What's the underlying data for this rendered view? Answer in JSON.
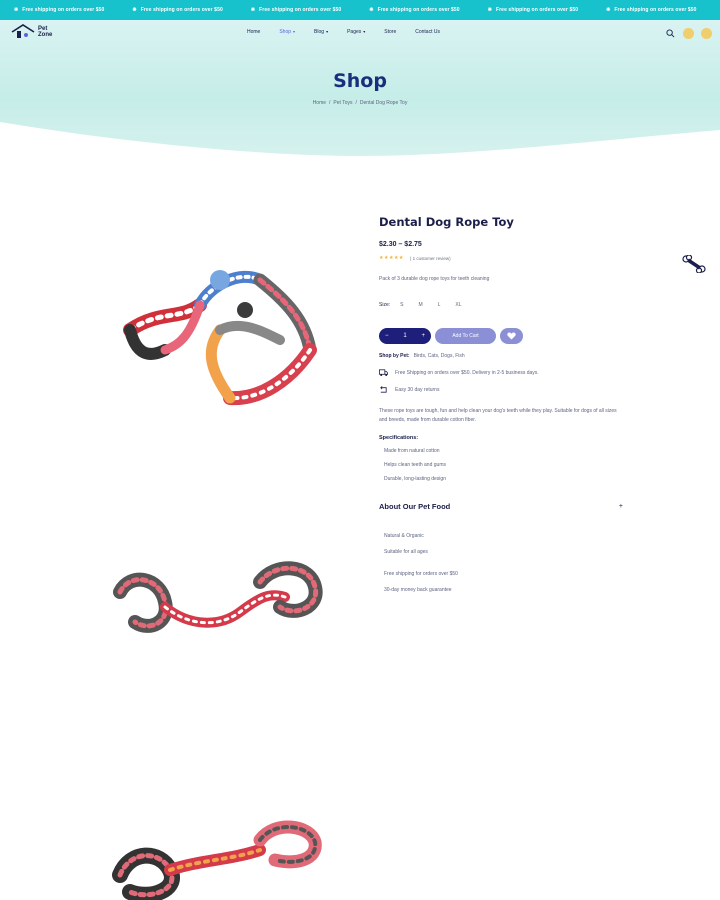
{
  "ticker": {
    "items": [
      "Free shipping on orders over $50",
      "Free shipping on orders over $50",
      "Free shipping on orders over $50",
      "Free shipping on orders over $50",
      "Free shipping on orders over $50",
      "Free shipping on orders over $50"
    ]
  },
  "brand": {
    "line1": "Pet",
    "line2": "Zone"
  },
  "nav": {
    "items": [
      {
        "label": "Home"
      },
      {
        "label": "Shop"
      },
      {
        "label": "Blog"
      },
      {
        "label": "Pages"
      },
      {
        "label": "Store"
      },
      {
        "label": "Contact Us"
      }
    ],
    "icons": [
      "search-icon",
      "user-icon",
      "cart-icon"
    ]
  },
  "hero": {
    "title": "Shop",
    "breadcrumb": [
      "Home",
      "Pet Toys",
      "Dental Dog Rope Toy"
    ]
  },
  "product": {
    "title": "Dental Dog Rope Toy",
    "price": "$2.30 – $2.75",
    "stars": "★★★★★",
    "rating": 5,
    "review_text": "( 1 customer review)",
    "short_desc": "Pack of 3 durable dog rope toys for teeth cleaning",
    "size_label": "Size:",
    "sizes": [
      "S",
      "M",
      "L",
      "XL"
    ],
    "qty": {
      "minus": "−",
      "value": "1",
      "plus": "+"
    },
    "add_to_cart": "Add To Cart",
    "shop_by_label": "Shop by Pet:",
    "shop_by_values": "Birds, Cats, Dogs, Fish",
    "features": [
      "Free Shipping on orders over $50. Delivery in 2-5 business days.",
      "Easy 30 day returns"
    ],
    "paragraph": "These rope toys are tough, fun and help clean your dog's teeth while they play. Suitable for dogs of all sizes and breeds, made from durable cotton fiber.",
    "spec_title": "Specifications:",
    "specs": [
      "Made from natural cotton",
      "Helps clean teeth and gums",
      "Durable, long-lasting design"
    ],
    "accordion": {
      "title": "About Our Pet Food",
      "toggle": "+",
      "lines_a": [
        "Natural & Organic",
        "Suitable for all ages"
      ],
      "lines_b": [
        "Free shipping for orders over $50",
        "30-day money back guarantee"
      ]
    }
  },
  "colors": {
    "teal": "#18c2cc",
    "navy": "#1d1f7a",
    "lavender": "#8b8fd6",
    "star": "#f3b32b"
  }
}
